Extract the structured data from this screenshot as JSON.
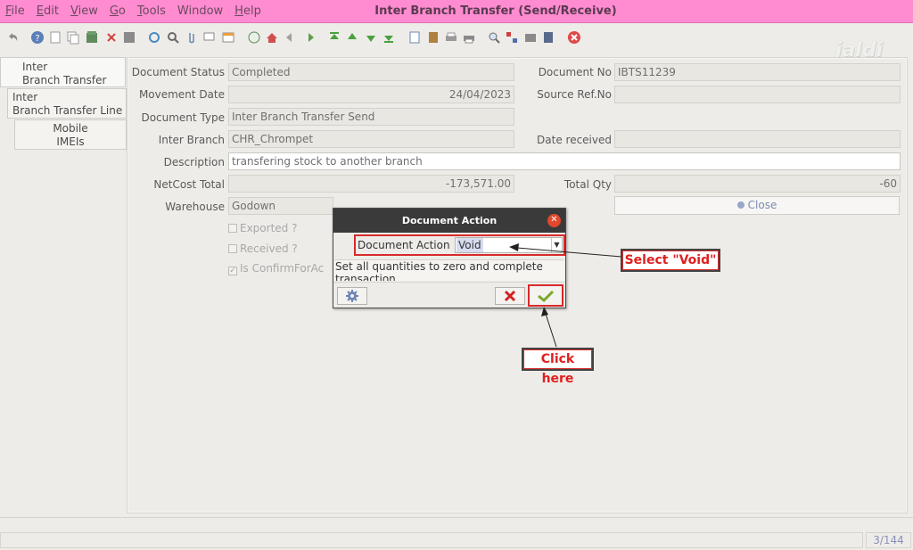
{
  "window": {
    "title": "Inter Branch Transfer (Send/Receive)",
    "menu": [
      {
        "first": "F",
        "rest": "ile"
      },
      {
        "first": "E",
        "rest": "dit"
      },
      {
        "first": "V",
        "rest": "iew"
      },
      {
        "first": "G",
        "rest": "o"
      },
      {
        "first": "T",
        "rest": "ools"
      },
      {
        "first": "",
        "rest": "Window"
      },
      {
        "first": "H",
        "rest": "elp"
      }
    ],
    "logo": "jaldi"
  },
  "tabs": {
    "t1": {
      "line1": "Inter",
      "line2": "Branch Transfer"
    },
    "t2": {
      "line1": "Inter",
      "line2": "Branch Transfer Line"
    },
    "t3": {
      "line1": "Mobile",
      "line2": "IMEIs"
    }
  },
  "form": {
    "document_status_label": "Document Status",
    "document_status": "Completed",
    "document_no_label": "Document No",
    "document_no": "IBTS11239",
    "movement_date_label": "Movement Date",
    "movement_date": "24/04/2023",
    "source_ref_label": "Source Ref.No",
    "source_ref": "",
    "document_type_label": "Document Type",
    "document_type": "Inter Branch Transfer Send",
    "inter_branch_label": "Inter Branch",
    "inter_branch": "CHR_Chrompet",
    "date_received_label": "Date received",
    "date_received": "",
    "description_label": "Description",
    "description": "transfering stock to another branch",
    "netcost_label": "NetCost Total",
    "netcost": "-173,571.00",
    "total_qty_label": "Total Qty",
    "total_qty": "-60",
    "warehouse_label": "Warehouse",
    "warehouse": "Godown",
    "close_button": "Close",
    "exported_label": "Exported ?",
    "received_label": "Received ?",
    "confirm_label": "Is ConfirmForAc"
  },
  "dialog": {
    "title": "Document Action",
    "action_label": "Document Action",
    "action_value": "Void",
    "message": "Set all quantities to zero and complete transaction"
  },
  "callouts": {
    "select_void": "Select \"Void\"",
    "click_here": "Click here"
  },
  "status": {
    "record_counter": "3/144"
  }
}
